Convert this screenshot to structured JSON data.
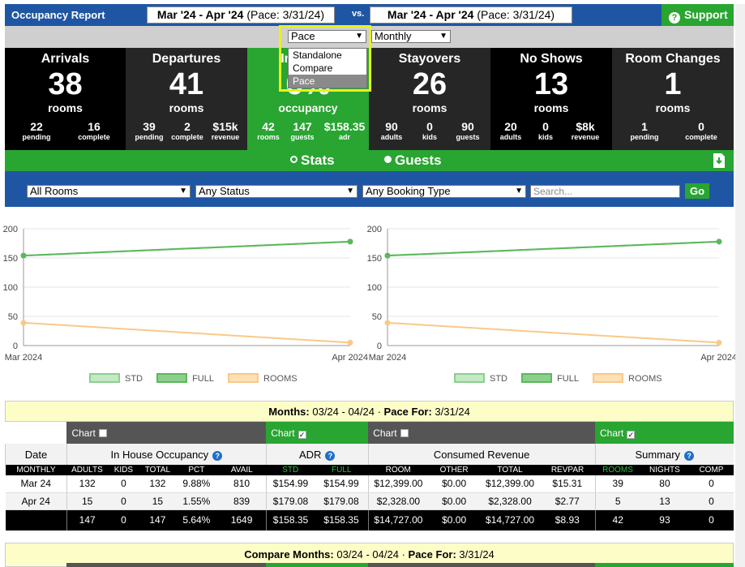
{
  "header": {
    "title": "Occupancy Report",
    "range1_bold": "Mar '24 - Apr '24",
    "range1_pace": "(Pace: 3/31/24)",
    "vs": "vs.",
    "range2_bold": "Mar '24 - Apr '24",
    "range2_pace": "(Pace: 3/31/24)",
    "support": "Support"
  },
  "selectors": {
    "mode": "Pace",
    "period": "Monthly",
    "mode_options": [
      "Standalone",
      "Compare",
      "Pace"
    ],
    "mode_selected_index": 2
  },
  "tiles": [
    {
      "title": "Arrivals",
      "value": "38",
      "unit": "rooms",
      "subs": [
        {
          "n": "22",
          "l": "pending"
        },
        {
          "n": "16",
          "l": "complete"
        }
      ]
    },
    {
      "title": "Departures",
      "value": "41",
      "unit": "rooms",
      "subs": [
        {
          "n": "39",
          "l": "pending"
        },
        {
          "n": "2",
          "l": "complete"
        },
        {
          "n": "$15k",
          "l": "revenue"
        }
      ]
    },
    {
      "title": "In House",
      "value": "6%",
      "unit": "occupancy",
      "subs": [
        {
          "n": "42",
          "l": "rooms"
        },
        {
          "n": "147",
          "l": "guests"
        },
        {
          "n": "$158.35",
          "l": "adr"
        }
      ]
    },
    {
      "title": "Stayovers",
      "value": "26",
      "unit": "rooms",
      "subs": [
        {
          "n": "90",
          "l": "adults"
        },
        {
          "n": "0",
          "l": "kids"
        },
        {
          "n": "90",
          "l": "guests"
        }
      ]
    },
    {
      "title": "No Shows",
      "value": "13",
      "unit": "rooms",
      "subs": [
        {
          "n": "20",
          "l": "adults"
        },
        {
          "n": "0",
          "l": "kids"
        },
        {
          "n": "$8k",
          "l": "revenue"
        }
      ]
    },
    {
      "title": "Room Changes",
      "value": "1",
      "unit": "rooms",
      "subs": [
        {
          "n": "1",
          "l": "pending"
        },
        {
          "n": "0",
          "l": "complete"
        }
      ]
    }
  ],
  "toggle": {
    "stats": "Stats",
    "guests": "Guests"
  },
  "filters": {
    "rooms": "All Rooms",
    "status": "Any Status",
    "booking": "Any Booking Type",
    "search_placeholder": "Search...",
    "go": "Go"
  },
  "chart_data": [
    {
      "type": "line",
      "x": [
        "Mar 2024",
        "Apr 2024"
      ],
      "ylim": [
        0,
        200
      ],
      "yticks": [
        0,
        50,
        100,
        150,
        200
      ],
      "series": [
        {
          "name": "STD",
          "values": [
            154,
            178
          ],
          "color": "#8ccf8c"
        },
        {
          "name": "FULL",
          "values": [
            154,
            178
          ],
          "color": "#5cb85c"
        },
        {
          "name": "ROOMS",
          "values": [
            39,
            5
          ],
          "color": "#f9c98a"
        }
      ]
    },
    {
      "type": "line",
      "x": [
        "Mar 2024",
        "Apr 2024"
      ],
      "ylim": [
        0,
        200
      ],
      "yticks": [
        0,
        50,
        100,
        150,
        200
      ],
      "series": [
        {
          "name": "STD",
          "values": [
            154,
            178
          ],
          "color": "#8ccf8c"
        },
        {
          "name": "FULL",
          "values": [
            154,
            178
          ],
          "color": "#5cb85c"
        },
        {
          "name": "ROOMS",
          "values": [
            39,
            5
          ],
          "color": "#f9c98a"
        }
      ]
    }
  ],
  "table": {
    "title_label": "Months:",
    "title_range": "03/24 - 04/24",
    "pace_label": "Pace For:",
    "pace_date": "3/31/24",
    "chart_label": "Chart",
    "groups": [
      "In House Occupancy",
      "ADR",
      "Consumed Revenue",
      "Summary"
    ],
    "date_label": "Date",
    "cols": [
      "MONTHLY",
      "ADULTS",
      "KIDS",
      "TOTAL",
      "PCT",
      "AVAIL",
      "STD",
      "FULL",
      "ROOM",
      "OTHER",
      "TOTAL",
      "REVPAR",
      "ROOMS",
      "NIGHTS",
      "COMP"
    ],
    "rows": [
      [
        "Mar 24",
        "132",
        "0",
        "132",
        "9.88%",
        "810",
        "$154.99",
        "$154.99",
        "$12,399.00",
        "$0.00",
        "$12,399.00",
        "$15.31",
        "39",
        "80",
        "0"
      ],
      [
        "Apr 24",
        "15",
        "0",
        "15",
        "1.55%",
        "839",
        "$179.08",
        "$179.08",
        "$2,328.00",
        "$0.00",
        "$2,328.00",
        "$2.77",
        "5",
        "13",
        "0"
      ]
    ],
    "totals": [
      "",
      "147",
      "0",
      "147",
      "5.64%",
      "1649",
      "$158.35",
      "$158.35",
      "$14,727.00",
      "$0.00",
      "$14,727.00",
      "$8.93",
      "42",
      "93",
      "0"
    ]
  },
  "compare_table": {
    "title_label": "Compare Months:",
    "title_range": "03/24 - 04/24",
    "pace_label": "Pace For:",
    "pace_date": "3/31/24"
  }
}
